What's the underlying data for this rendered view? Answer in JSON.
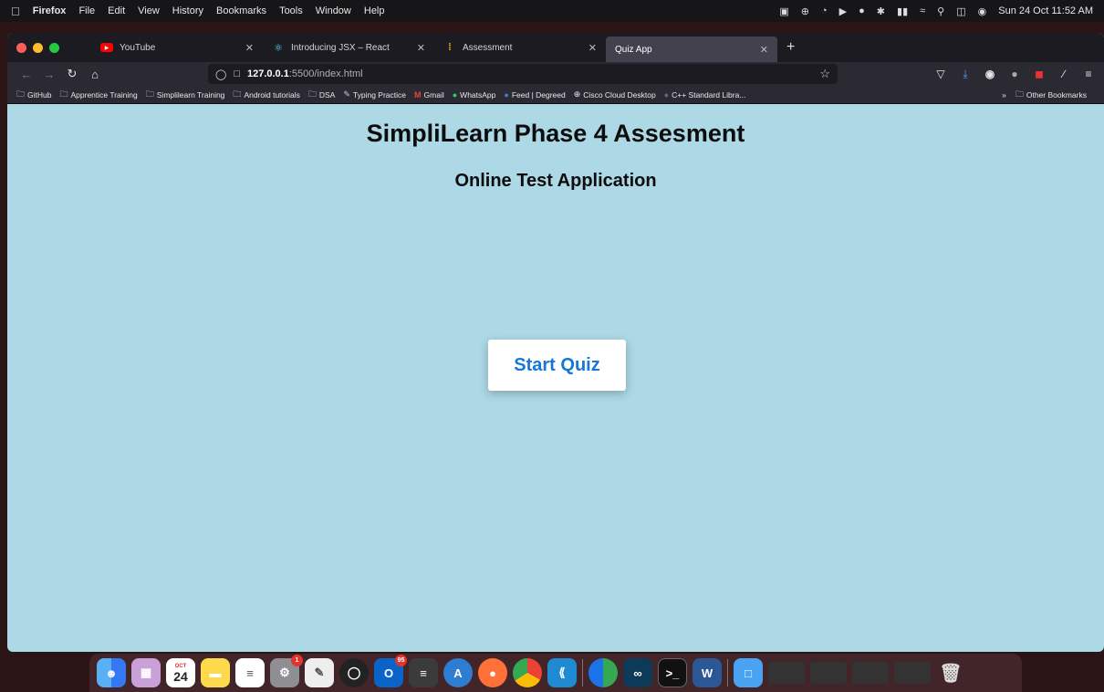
{
  "menubar": {
    "app": "Firefox",
    "items": [
      "File",
      "Edit",
      "View",
      "History",
      "Bookmarks",
      "Tools",
      "Window",
      "Help"
    ],
    "clock": "Sun 24 Oct  11:52 AM"
  },
  "tabs": [
    {
      "title": "YouTube",
      "icon": "youtube-icon",
      "color": "#ff0000"
    },
    {
      "title": "Introducing JSX – React",
      "icon": "react-icon",
      "color": "#61dafb"
    },
    {
      "title": "Assessment",
      "icon": "assessment-icon",
      "color": "#f0b400"
    },
    {
      "title": "Quiz App",
      "icon": "",
      "color": "#ffffff"
    }
  ],
  "url": {
    "host": "127.0.0.1",
    "path": ":5500/index.html"
  },
  "bookmarks": [
    "GitHub",
    "Apprentice Training",
    "Simplilearn Training",
    "Android tutorials",
    "DSA",
    "Typing Practice",
    "Gmail",
    "WhatsApp",
    "Feed | Degreed",
    "Cisco Cloud Desktop",
    "C++ Standard Libra..."
  ],
  "bookmarks_other": "Other Bookmarks",
  "page": {
    "title": "SimpliLearn Phase 4 Assesment",
    "subtitle": "Online Test Application",
    "start_button": "Start Quiz"
  },
  "dock": {
    "calendar_month": "OCT",
    "calendar_day": "24",
    "badge_settings": "1",
    "badge_outlook": "95"
  },
  "colors": {
    "page_bg": "#add8e6",
    "button_text": "#1877d4",
    "title_text": "#0d0d0d"
  }
}
